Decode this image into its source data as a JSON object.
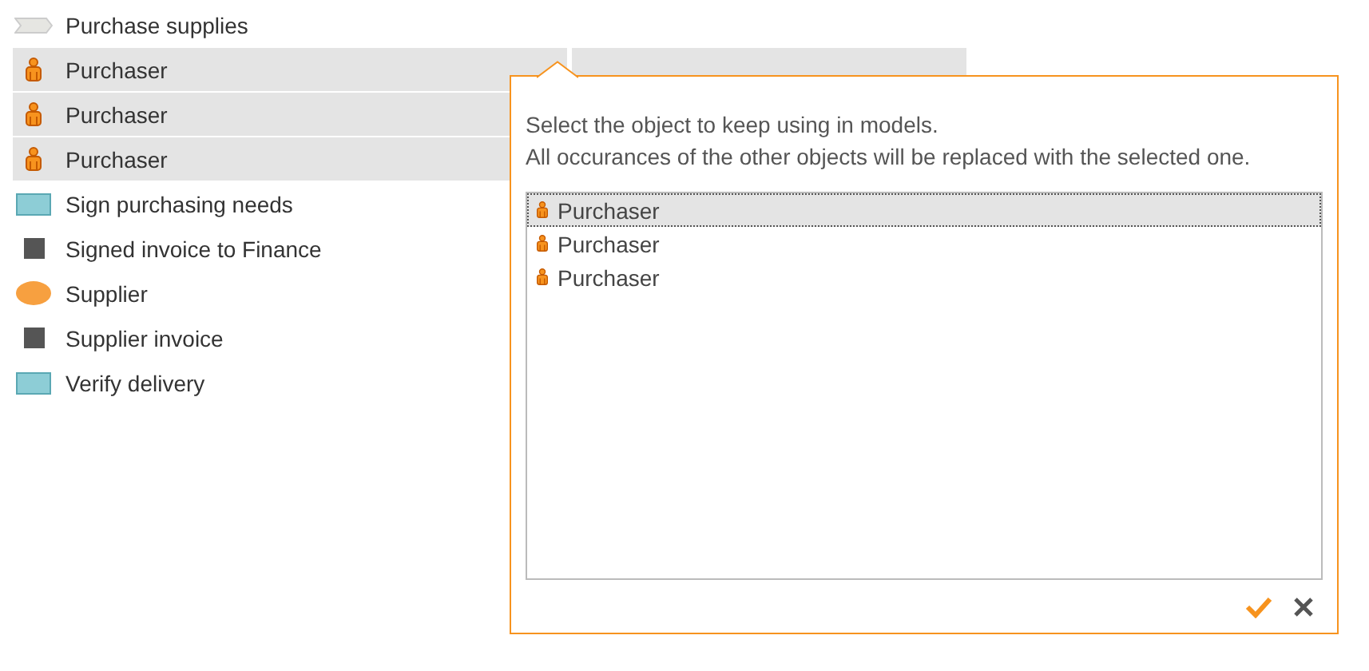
{
  "items": [
    {
      "kind": "process",
      "label": "Purchase supplies",
      "selected": false
    },
    {
      "kind": "role",
      "label": "Purchaser",
      "selected": true
    },
    {
      "kind": "role",
      "label": "Purchaser",
      "selected": true
    },
    {
      "kind": "role",
      "label": "Purchaser",
      "selected": true
    },
    {
      "kind": "task",
      "label": "Sign purchasing needs",
      "selected": false
    },
    {
      "kind": "document",
      "label": "Signed invoice to Finance",
      "selected": false
    },
    {
      "kind": "participant",
      "label": "Supplier",
      "selected": false
    },
    {
      "kind": "document",
      "label": "Supplier invoice",
      "selected": false
    },
    {
      "kind": "task",
      "label": "Verify delivery",
      "selected": false
    }
  ],
  "popover": {
    "message": [
      "Select the object to keep using in models.",
      "All occurances of the other objects will be replaced with the selected one."
    ],
    "options": [
      {
        "kind": "role",
        "label": "Purchaser",
        "selected": true
      },
      {
        "kind": "role",
        "label": "Purchaser",
        "selected": false
      },
      {
        "kind": "role",
        "label": "Purchaser",
        "selected": false
      }
    ]
  }
}
